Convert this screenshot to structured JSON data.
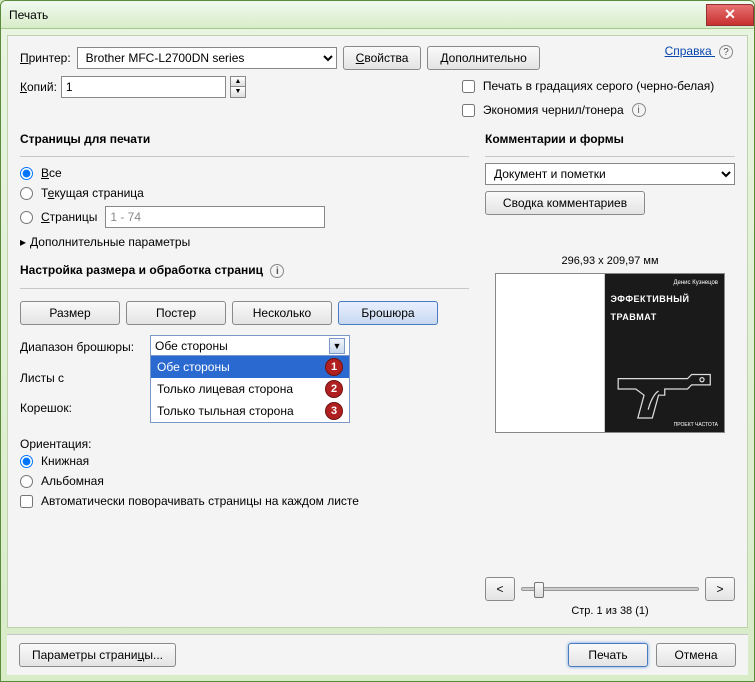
{
  "window": {
    "title": "Печать"
  },
  "header": {
    "printer_label": "Принтер:",
    "printer_value": "Brother MFC-L2700DN series",
    "properties_btn": "Свойства",
    "advanced_btn": "Дополнительно",
    "help_link": "Справка",
    "copies_label": "Копий:",
    "copies_value": "1",
    "grayscale_label": "Печать в градациях серого (черно-белая)",
    "ink_save_label": "Экономия чернил/тонера"
  },
  "pages": {
    "section_title": "Страницы для печати",
    "options": {
      "all": "Все",
      "current": "Текущая страница",
      "range": "Страницы"
    },
    "range_value": "1 - 74",
    "more_params": "Дополнительные параметры"
  },
  "sizing": {
    "section_title": "Настройка размера и обработка страниц",
    "buttons": {
      "size": "Размер",
      "poster": "Постер",
      "multiple": "Несколько",
      "booklet": "Брошюра"
    },
    "booklet_range_label": "Диапазон брошюры:",
    "sheets_label": "Листы с",
    "spine_label": "Корешок:",
    "dropdown": {
      "selected": "Обе стороны",
      "options": [
        "Обе стороны",
        "Только лицевая сторона",
        "Только тыльная сторона"
      ],
      "badges": [
        "1",
        "2",
        "3"
      ]
    }
  },
  "orientation": {
    "section_title": "Ориентация:",
    "portrait": "Книжная",
    "landscape": "Альбомная",
    "autorotate": "Автоматически поворачивать страницы на каждом листе"
  },
  "comments": {
    "section_title": "Комментарии и формы",
    "dropdown_value": "Документ и пометки",
    "summary_btn": "Сводка комментариев"
  },
  "preview": {
    "dimensions": "296,93 x 209,97 мм",
    "book_author": "Денис Кузнецов",
    "book_title1": "ЭФФЕКТИВНЫЙ",
    "book_title2": "ТРАВМАТ",
    "book_footer": "ПРОЕКТ ЧАСТОТА",
    "nav_prev": "<",
    "nav_next": ">",
    "page_indicator": "Стр. 1 из 38 (1)"
  },
  "footer": {
    "page_setup_btn": "Параметры страницы...",
    "print_btn": "Печать",
    "cancel_btn": "Отмена"
  }
}
